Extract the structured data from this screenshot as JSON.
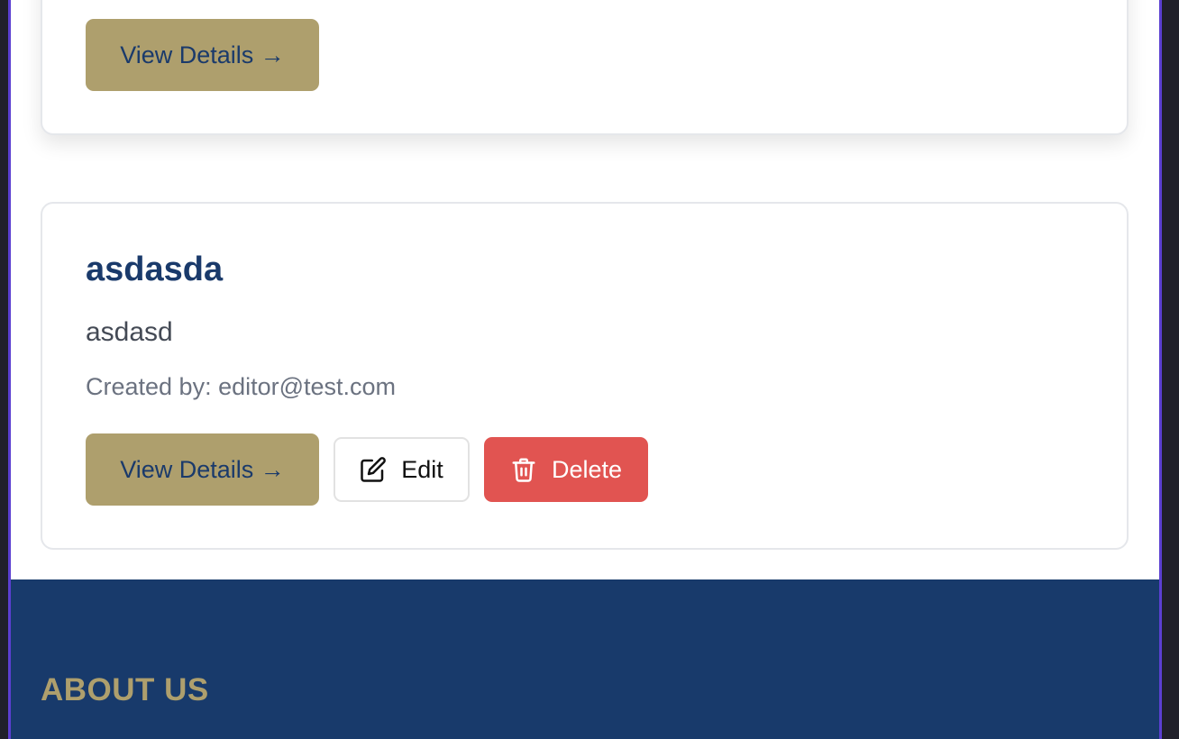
{
  "cards": [
    {
      "view_label": "View Details →"
    },
    {
      "title": "asdasda",
      "description": "asdasd",
      "created_by": "Created by: editor@test.com",
      "view_label": "View Details →",
      "edit_label": "Edit",
      "delete_label": "Delete"
    }
  ],
  "footer": {
    "heading": "ABOUT US"
  },
  "colors": {
    "gold": "#ae9f6d",
    "navy": "#1a3a6b",
    "danger": "#e15451",
    "footer_bg": "#183a6b",
    "frame_accent": "#5b3fd1"
  },
  "icons": {
    "edit": "edit-icon",
    "delete": "trash-icon"
  }
}
